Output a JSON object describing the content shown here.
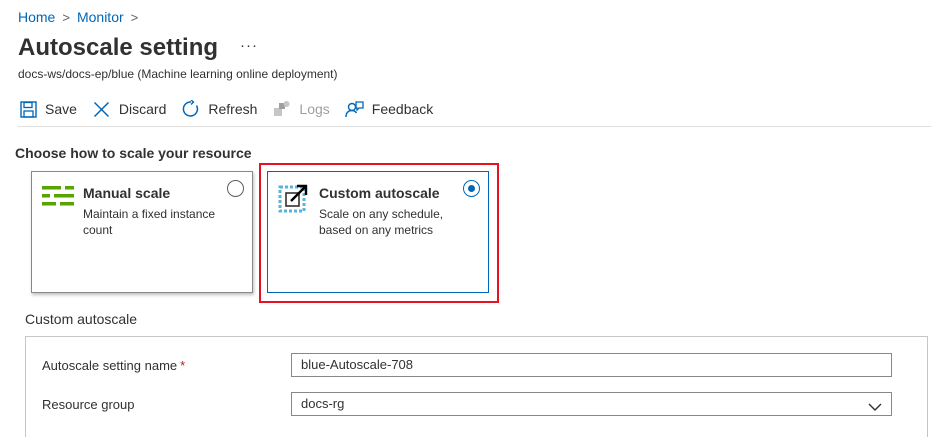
{
  "breadcrumb": {
    "home": "Home",
    "monitor": "Monitor",
    "sep": ">"
  },
  "page": {
    "title": "Autoscale setting",
    "more": "···",
    "subtitle": "docs-ws/docs-ep/blue (Machine learning online deployment)"
  },
  "toolbar": {
    "save": "Save",
    "discard": "Discard",
    "refresh": "Refresh",
    "logs": "Logs",
    "feedback": "Feedback"
  },
  "scale": {
    "heading": "Choose how to scale your resource",
    "manual": {
      "title": "Manual scale",
      "desc": "Maintain a fixed instance count",
      "selected": false
    },
    "custom": {
      "title": "Custom autoscale",
      "desc": "Scale on any schedule, based on any metrics",
      "selected": true
    }
  },
  "custom_panel": {
    "label": "Custom autoscale",
    "setting_name_label": "Autoscale setting name",
    "required_mark": "*",
    "setting_name_value": "blue-Autoscale-708",
    "resource_group_label": "Resource group",
    "resource_group_value": "docs-rg"
  },
  "colors": {
    "accent": "#0067b8",
    "highlight": "#e81123",
    "manual_icon": "#57a300",
    "custom_icon": "#59b4d9"
  },
  "icons": [
    "save-icon",
    "discard-icon",
    "refresh-icon",
    "logs-icon",
    "feedback-icon",
    "manual-scale-icon",
    "custom-autoscale-icon",
    "chevron-down-icon"
  ]
}
